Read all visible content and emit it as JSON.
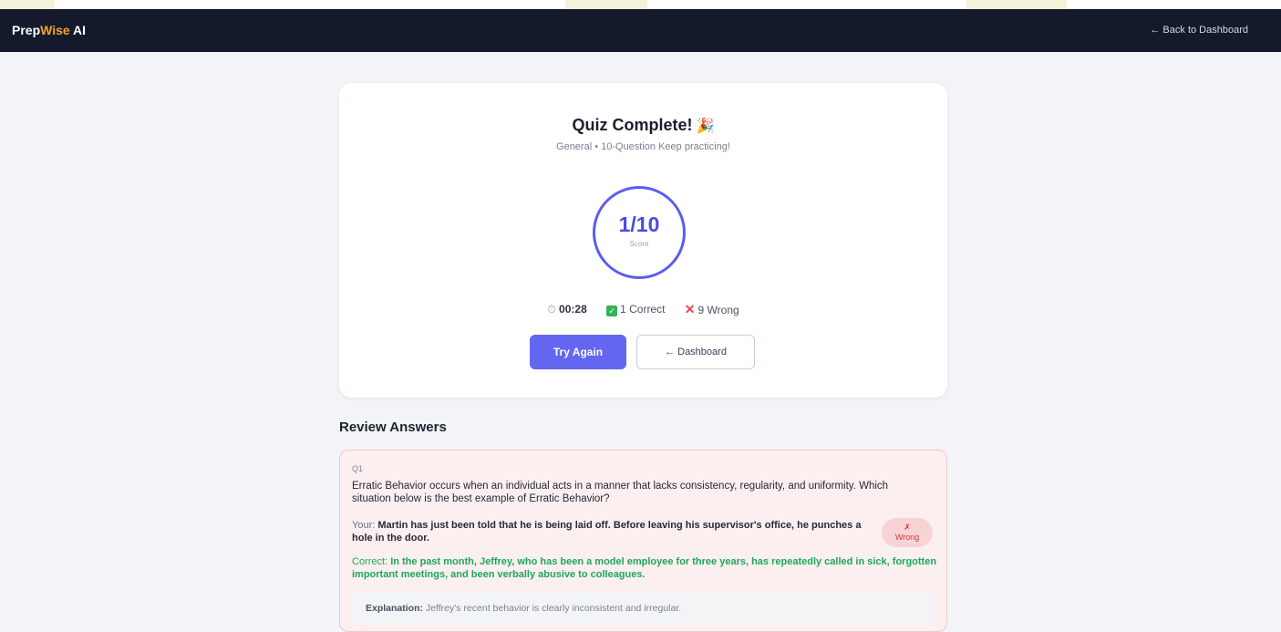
{
  "nav": {
    "brand_prefix": "Prep",
    "brand_accent": "Wise",
    "brand_suffix": " AI",
    "back_link": "← Back to Dashboard"
  },
  "result": {
    "title": "Quiz Complete!",
    "title_icon": "🎉",
    "subtitle": "General • 10-Question Keep practicing!",
    "score": "1/10",
    "score_label": "Score",
    "time": "00:28",
    "correct_text": "1 Correct",
    "wrong_text": "9 Wrong",
    "try_again_label": "Try Again",
    "dashboard_label": "← Dashboard"
  },
  "review": {
    "heading": "Review Answers",
    "items": [
      {
        "number": "Q1",
        "question": "Erratic Behavior occurs when an individual acts in a manner that lacks consistency, regularity, and uniformity. Which situation below is the best example of Erratic Behavior?",
        "your_label": "Your:",
        "your_answer": "Martin has just been told that he is being laid off. Before leaving his supervisor's office, he punches a hole in the door.",
        "status_icon": "✗",
        "status_text": "Wrong",
        "correct_label": "Correct:",
        "correct_answer": "In the past month, Jeffrey, who has been a model employee for three years, has repeatedly called in sick, forgotten important meetings, and been verbally abusive to colleagues.",
        "explanation_label": "Explanation:",
        "explanation": "Jeffrey's recent behavior is clearly inconsistent and irregular."
      }
    ]
  },
  "icons": {
    "timer": "timer-icon",
    "check": "check-icon",
    "wrong": "x-icon",
    "party": "party-popper-icon"
  },
  "colors": {
    "navbar_bg": "#141a2c",
    "brand_accent": "#f5a524",
    "primary": "#6366f1",
    "correct": "#1ea85a",
    "wrong": "#e5484d",
    "review_card_bg": "#fbeff0"
  }
}
